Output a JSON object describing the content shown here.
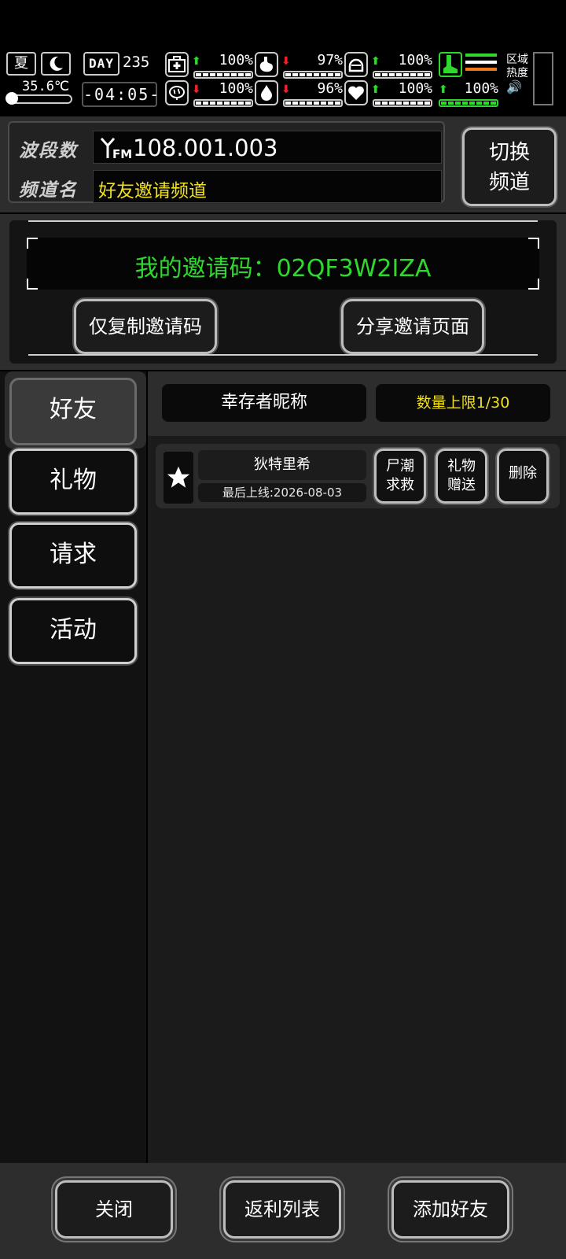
{
  "hud": {
    "season": "夏",
    "temperature": "35.6℃",
    "day_label": "DAY",
    "day": "235",
    "clock": "-04:05-",
    "stats": [
      {
        "icon": "medkit-icon",
        "trend": "up",
        "arrow": "⬆",
        "value": "100%"
      },
      {
        "icon": "stomach-icon",
        "trend": "down",
        "arrow": "⬇",
        "value": "97%"
      },
      {
        "icon": "helmet-icon",
        "trend": "up",
        "arrow": "⬆",
        "value": "100%"
      },
      {
        "icon": "brain-icon",
        "trend": "down",
        "arrow": "⬇",
        "value": "100%"
      },
      {
        "icon": "water-drop-icon",
        "trend": "down",
        "arrow": "⬇",
        "value": "96%"
      },
      {
        "icon": "heart-icon",
        "trend": "up",
        "arrow": "⬆",
        "value": "100%"
      },
      {
        "icon": "legs-icon",
        "trend": "up",
        "arrow": "⬆",
        "value": "100%"
      }
    ],
    "area_heat_label_1": "区域",
    "area_heat_label_2": "热度",
    "sound_glyph": "🔊"
  },
  "channel": {
    "freq_label": "波段数",
    "freq_value": "108.001.003",
    "name_label": "频道名",
    "name_value": "好友邀请频道",
    "switch_line1": "切换",
    "switch_line2": "频道"
  },
  "invite": {
    "code_text": "我的邀请码：02QF3W2IZA",
    "copy_button": "仅复制邀请码",
    "share_button": "分享邀请页面"
  },
  "tabs": [
    {
      "label": "好友",
      "active": true
    },
    {
      "label": "礼物",
      "active": false
    },
    {
      "label": "请求",
      "active": false
    },
    {
      "label": "活动",
      "active": false
    }
  ],
  "list_header": {
    "nickname_col": "幸存者昵称",
    "limit": "数量上限1/30"
  },
  "friends": [
    {
      "name": "狄特里希",
      "last_online": "最后上线:2026-08-03",
      "btn_rescue_1": "尸潮",
      "btn_rescue_2": "求救",
      "btn_gift_1": "礼物",
      "btn_gift_2": "赠送",
      "btn_delete": "删除"
    }
  ],
  "footer": {
    "close": "关闭",
    "rebate_list": "返利列表",
    "add_friend": "添加好友"
  },
  "colors": {
    "accent_green": "#2fd82f",
    "accent_yellow": "#f0e020",
    "down_red": "#e8232a"
  }
}
